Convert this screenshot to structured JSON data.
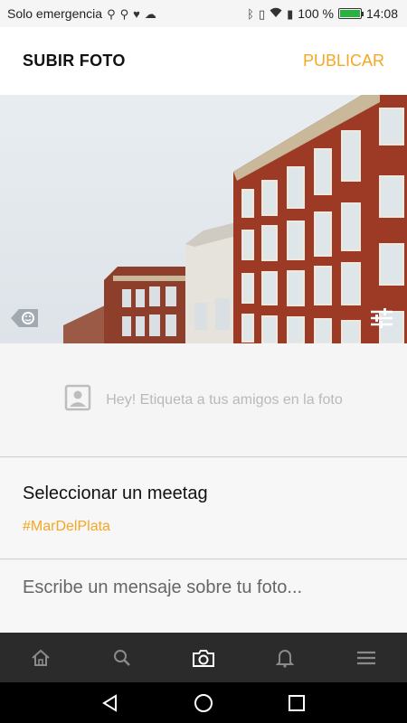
{
  "status_bar": {
    "left_text": "Solo emergencia",
    "battery_text": "100 %",
    "battery_level": 1.0,
    "time": "14:08",
    "icons": [
      "usb-icon",
      "usb-icon",
      "heart-rate-icon",
      "cloud-icon",
      "bluetooth-icon",
      "vibrate-icon",
      "wifi-icon",
      "sim-icon",
      "battery-icon"
    ]
  },
  "header": {
    "title": "SUBIR FOTO",
    "publish_label": "PUBLICAR"
  },
  "photo": {
    "tag_icon": "tag-face-icon",
    "filter_icon": "filter-sliders-icon"
  },
  "tag_friends": {
    "hint": "Hey! Etiqueta a tus amigos en la foto",
    "icon": "portrait-icon"
  },
  "meetag": {
    "label": "Seleccionar un meetag",
    "value": "#MarDelPlata"
  },
  "message": {
    "placeholder": "Escribe un mensaje sobre tu foto..."
  },
  "bottom_nav": {
    "items": [
      "home-icon",
      "search-icon",
      "camera-icon",
      "bell-icon",
      "menu-icon"
    ]
  },
  "android_nav": {
    "items": [
      "back-icon",
      "home-circle-icon",
      "recents-icon"
    ]
  },
  "colors": {
    "accent": "#f5a623",
    "nav_bg": "#2b2b2b",
    "battery_green": "#27b33e"
  }
}
